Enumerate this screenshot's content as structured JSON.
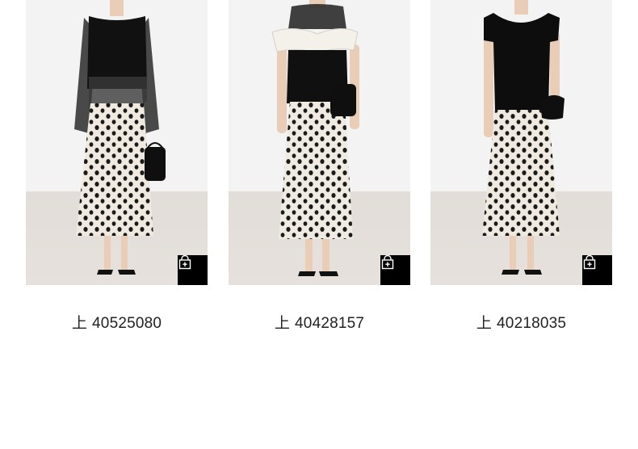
{
  "products": [
    {
      "prefix": "上",
      "code": "40525080",
      "cart_icon": "shopping-bag-plus-icon"
    },
    {
      "prefix": "上",
      "code": "40428157",
      "cart_icon": "shopping-bag-plus-icon"
    },
    {
      "prefix": "上",
      "code": "40218035",
      "cart_icon": "shopping-bag-plus-icon"
    }
  ],
  "colors": {
    "studio_wall": "#f3f3f3",
    "studio_floor": "#e2ddd8",
    "cart_button": "#000000",
    "caption_text": "#222222"
  }
}
